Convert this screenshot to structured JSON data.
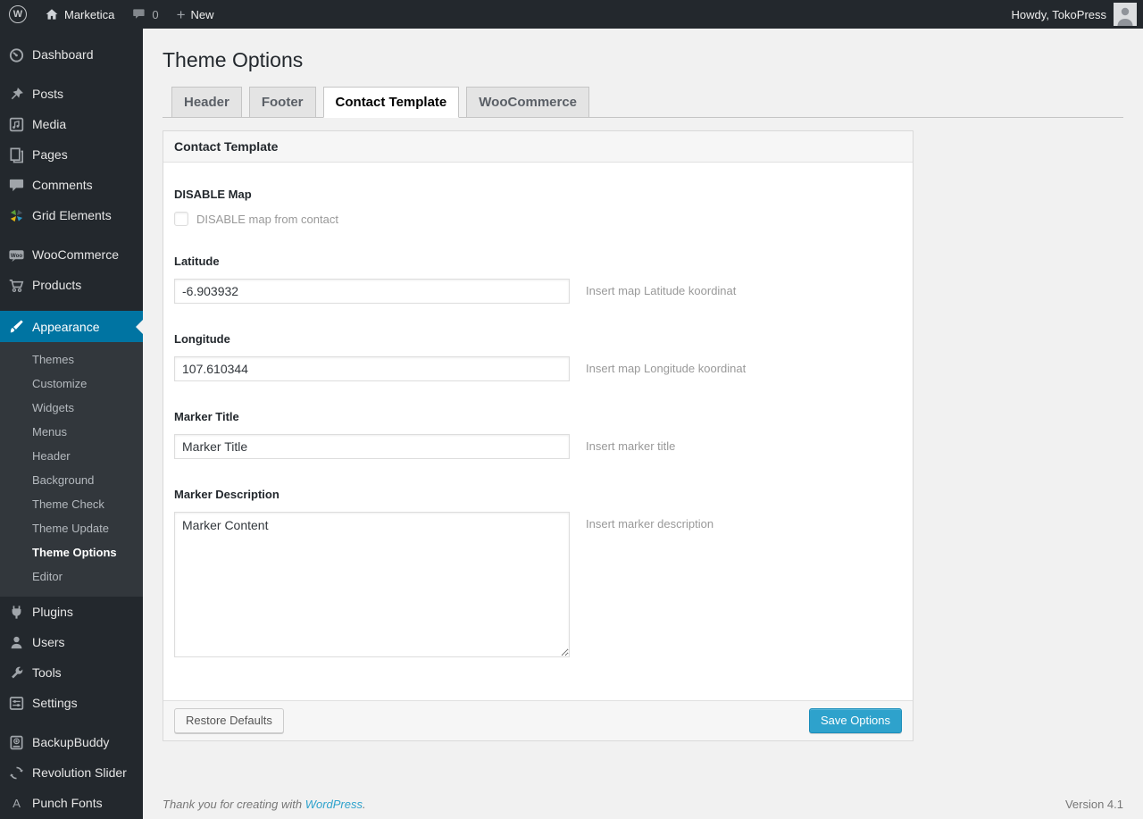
{
  "admin_bar": {
    "site_name": "Marketica",
    "comment_count": "0",
    "new_label": "New",
    "howdy": "Howdy, TokoPress"
  },
  "icons": {
    "wp_logo_glyph": "W",
    "new_plus_glyph": "+",
    "woocommerce_badge_text": "Woo",
    "punch_fonts_glyph": "A"
  },
  "sidebar": {
    "items": [
      {
        "label": "Dashboard",
        "icon": "dashboard-icon"
      },
      {
        "label": "Posts",
        "icon": "pushpin-icon"
      },
      {
        "label": "Media",
        "icon": "media-icon"
      },
      {
        "label": "Pages",
        "icon": "pages-icon"
      },
      {
        "label": "Comments",
        "icon": "comment-bubble-icon"
      },
      {
        "label": "Grid Elements",
        "icon": "pinwheel-icon"
      },
      {
        "label": "WooCommerce",
        "icon": "woo-badge-icon"
      },
      {
        "label": "Products",
        "icon": "cart-icon"
      },
      {
        "label": "Appearance",
        "icon": "paintbrush-icon",
        "active": true
      },
      {
        "label": "Plugins",
        "icon": "plug-icon"
      },
      {
        "label": "Users",
        "icon": "person-icon"
      },
      {
        "label": "Tools",
        "icon": "wrench-icon"
      },
      {
        "label": "Settings",
        "icon": "sliders-icon"
      },
      {
        "label": "BackupBuddy",
        "icon": "backup-drive-icon"
      },
      {
        "label": "Revolution Slider",
        "icon": "refresh-arrows-icon"
      },
      {
        "label": "Punch Fonts",
        "icon": "letter-a-icon"
      }
    ],
    "appearance_submenu": {
      "items": [
        {
          "label": "Themes"
        },
        {
          "label": "Customize"
        },
        {
          "label": "Widgets"
        },
        {
          "label": "Menus"
        },
        {
          "label": "Header"
        },
        {
          "label": "Background"
        },
        {
          "label": "Theme Check"
        },
        {
          "label": "Theme Update"
        },
        {
          "label": "Theme Options",
          "active": true
        },
        {
          "label": "Editor"
        }
      ]
    }
  },
  "page": {
    "title": "Theme Options"
  },
  "tabs": {
    "items": [
      {
        "label": "Header",
        "active": false
      },
      {
        "label": "Footer",
        "active": false
      },
      {
        "label": "Contact Template",
        "active": true
      },
      {
        "label": "WooCommerce",
        "active": false
      }
    ]
  },
  "panel": {
    "title": "Contact Template",
    "disable_map": {
      "label": "DISABLE Map",
      "checkbox_label": "DISABLE map from contact",
      "checked": false
    },
    "latitude": {
      "label": "Latitude",
      "value": "-6.903932",
      "hint": "Insert map Latitude koordinat"
    },
    "longitude": {
      "label": "Longitude",
      "value": "107.610344",
      "hint": "Insert map Longitude koordinat"
    },
    "marker_title": {
      "label": "Marker Title",
      "value": "Marker Title",
      "hint": "Insert marker title"
    },
    "marker_description": {
      "label": "Marker Description",
      "value": "Marker Content",
      "hint": "Insert marker description"
    },
    "actions": {
      "restore_label": "Restore Defaults",
      "save_label": "Save Options"
    }
  },
  "page_footer": {
    "thanks_text": "Thank you for creating with",
    "link_label": "WordPress",
    "period": ".",
    "version": "Version 4.1"
  },
  "colors": {
    "menu_bg": "#23282d",
    "submenu_bg": "#32373c",
    "accent_blue": "#0074a2",
    "primary_button_blue": "#2ea2cc",
    "page_bg": "#f1f1f1",
    "link_blue": "#2ea2cc"
  }
}
